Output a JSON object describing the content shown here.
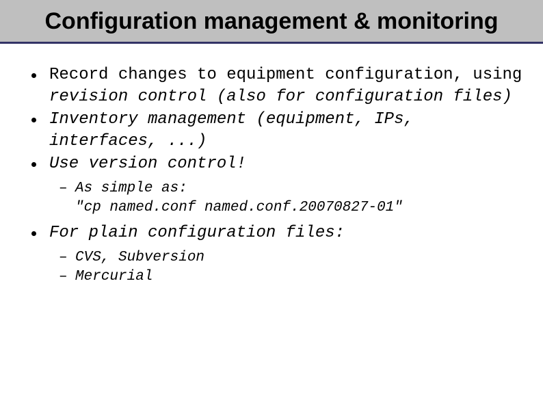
{
  "title": "Configuration management & monitoring",
  "bullets": {
    "b1_pre": "Record changes to equipment configuration, using ",
    "b1_em": "revision control (also for configuration files)",
    "b2": "Inventory management (equipment, IPs, interfaces, ...)",
    "b3": "Use version control!",
    "b3_sub1_line1": "As simple as:",
    "b3_sub1_line2": "\"cp named.conf named.conf.20070827-01\"",
    "b4": "For plain configuration files:",
    "b4_sub1": "CVS, Subversion",
    "b4_sub2": "Mercurial"
  }
}
